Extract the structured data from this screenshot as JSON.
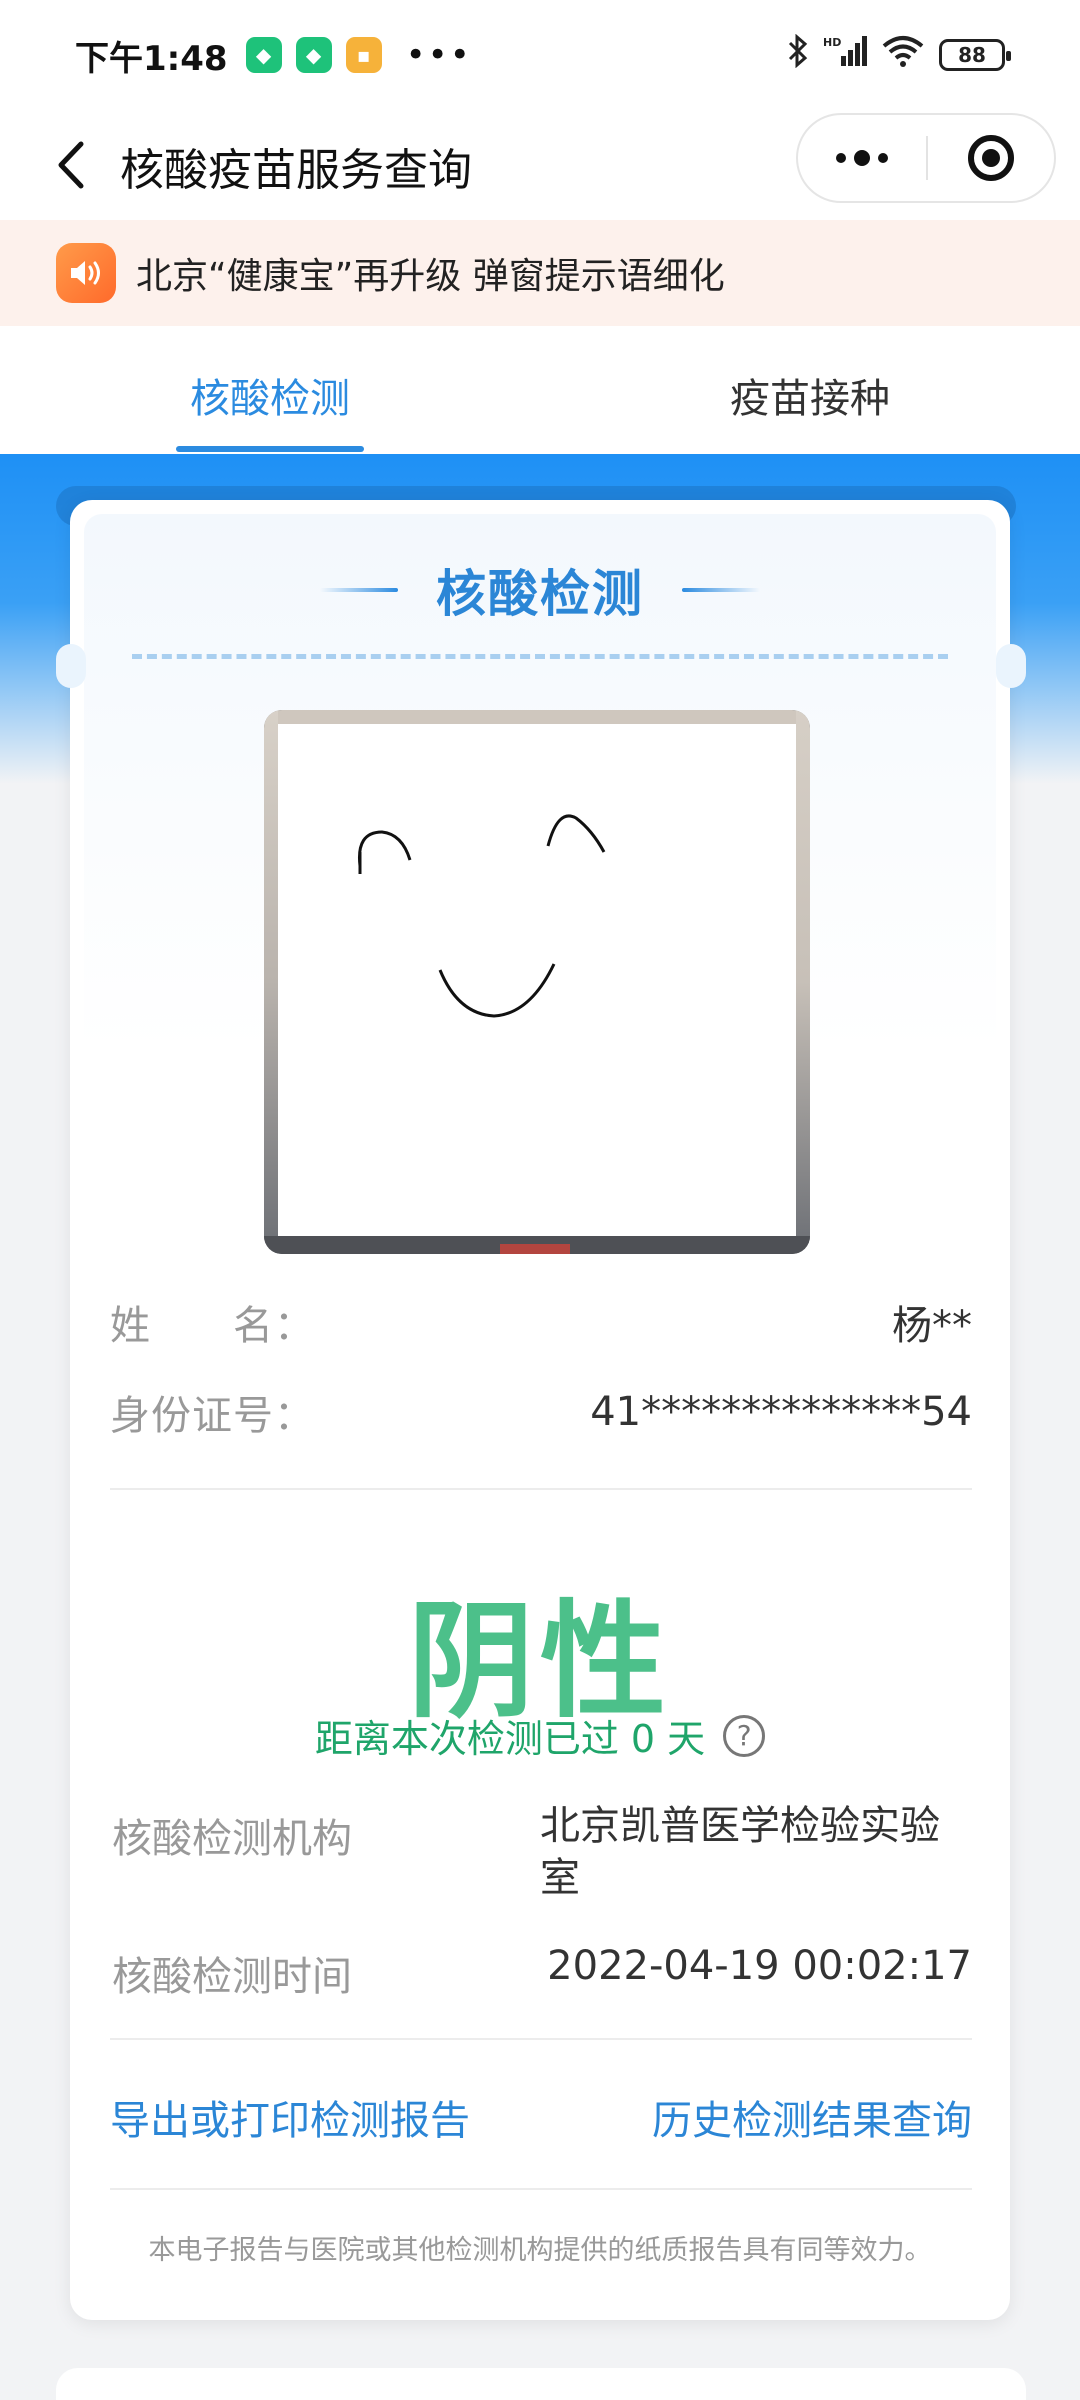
{
  "status_bar": {
    "time": "下午1:48",
    "dots": "•••",
    "battery": "88",
    "app_icon_colors": [
      "#1ec27a",
      "#1ec27a",
      "#f6b23a"
    ],
    "icons": [
      "bluetooth-icon",
      "signal-icon",
      "wifi-icon",
      "battery-icon"
    ]
  },
  "nav": {
    "title": "核酸疫苗服务查询"
  },
  "notice": {
    "text": "北京“健康宝”再升级 弹窗提示语细化"
  },
  "tabs": [
    {
      "label": "核酸检测",
      "active": true
    },
    {
      "label": "疫苗接种",
      "active": false
    }
  ],
  "card": {
    "title": "核酸检测",
    "name_label": "姓　　名：",
    "name_value": "杨**",
    "id_label": "身份证号：",
    "id_value": "41**************54",
    "result": "阴性",
    "since_text": "距离本次检测已过 0 天",
    "help_symbol": "?",
    "institution_label": "核酸检测机构",
    "institution_value_line1": "北京凯普医学检验实验",
    "institution_value_line2": "室",
    "time_label": "核酸检测时间",
    "time_value": "2022-04-19 00:02:17",
    "export_link": "导出或打印检测报告",
    "history_link": "历史检测结果查询",
    "footnote": "本电子报告与医院或其他检测机构提供的纸质报告具有同等效力。"
  },
  "colors": {
    "accent_blue": "#2b8be0",
    "result_green": "#4cc08a",
    "since_green": "#1fa56a"
  }
}
